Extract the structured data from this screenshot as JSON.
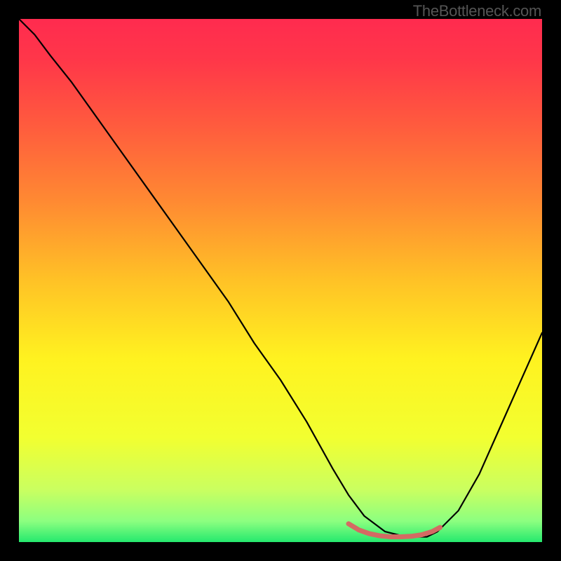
{
  "watermark": "TheBottleneck.com",
  "chart_data": {
    "type": "line",
    "title": "",
    "xlabel": "",
    "ylabel": "",
    "xlim": [
      0,
      100
    ],
    "ylim": [
      0,
      100
    ],
    "background_gradient": {
      "stops": [
        {
          "offset": 0.0,
          "color": "#ff2b4f"
        },
        {
          "offset": 0.08,
          "color": "#ff3749"
        },
        {
          "offset": 0.2,
          "color": "#ff5a3e"
        },
        {
          "offset": 0.35,
          "color": "#ff8a32"
        },
        {
          "offset": 0.5,
          "color": "#ffc226"
        },
        {
          "offset": 0.65,
          "color": "#fff220"
        },
        {
          "offset": 0.8,
          "color": "#f2ff30"
        },
        {
          "offset": 0.9,
          "color": "#caff60"
        },
        {
          "offset": 0.96,
          "color": "#8cff80"
        },
        {
          "offset": 1.0,
          "color": "#25e96e"
        }
      ]
    },
    "series": [
      {
        "name": "bottleneck-curve",
        "color": "#000000",
        "width": 2.2,
        "x": [
          0,
          3,
          6,
          10,
          15,
          20,
          25,
          30,
          35,
          40,
          45,
          50,
          55,
          60,
          63,
          66,
          70,
          74,
          78,
          80,
          84,
          88,
          92,
          96,
          100
        ],
        "y": [
          100,
          97,
          93,
          88,
          81,
          74,
          67,
          60,
          53,
          46,
          38,
          31,
          23,
          14,
          9,
          5,
          2,
          1,
          1,
          2,
          6,
          13,
          22,
          31,
          40
        ]
      },
      {
        "name": "optimal-zone-marker",
        "color": "#d46a63",
        "width": 7,
        "x": [
          63,
          65,
          67,
          69,
          71,
          73,
          75,
          77,
          79,
          80.5
        ],
        "y": [
          3.5,
          2.3,
          1.6,
          1.2,
          1.0,
          1.0,
          1.1,
          1.4,
          2.0,
          2.8
        ]
      }
    ]
  }
}
